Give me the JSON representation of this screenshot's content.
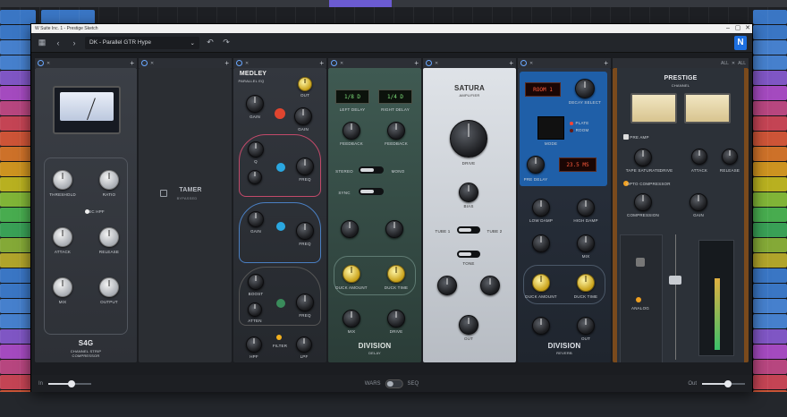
{
  "window": {
    "title": "W Suite Inc. 1 - Prestige Sketch",
    "minimize": "–",
    "maximize": "▢",
    "close": "✕"
  },
  "toolbar": {
    "menu_icon": "grid-icon",
    "prev_icon": "chevron-left-icon",
    "next_icon": "chevron-right-icon",
    "preset_name": "DK - Parallel GTR Hype",
    "preset_caret": "⌄",
    "undo_icon": "undo-icon",
    "redo_icon": "redo-icon",
    "brand": "N"
  },
  "slots": [
    {
      "plugin": "S4G",
      "subtitle": "CHANNEL STRIP COMPRESSOR",
      "controls": [
        "THRESHOLD",
        "RATIO",
        "SC HPF",
        "ATTACK",
        "RELEASE",
        "MIX",
        "OUTPUT"
      ]
    },
    {
      "plugin": "TAMER",
      "subtitle": "BYPASSED"
    },
    {
      "plugin": "MEDLEY",
      "subtitle": "PARALLEL EQ",
      "controls": [
        "OUT",
        "GAIN",
        "FREQ",
        "GAIN",
        "Q",
        "FREQ",
        "GAIN",
        "Q",
        "FREQ",
        "BOOST",
        "ATTEN",
        "FREQ",
        "HPF",
        "FILTER",
        "LPF"
      ]
    },
    {
      "plugin": "DIVISION",
      "subtitle": "DELAY",
      "left_delay": "LEFT DELAY",
      "right_delay": "RIGHT DELAY",
      "left_value": "1/8 D",
      "right_value": "1/4 D",
      "controls": [
        "FEEDBACK",
        "FEEDBACK",
        "STEREO",
        "MONO",
        "SYNC",
        "DUCK AMOUNT",
        "DUCK TIME",
        "MIX",
        "DRIVE"
      ]
    },
    {
      "plugin": "SATURA",
      "subtitle": "AMPLIFIER",
      "controls": [
        "DRIVE",
        "BIAS",
        "TUBE 1",
        "TUBE 2",
        "TONE",
        "OUT"
      ]
    },
    {
      "plugin": "DIVISION",
      "subtitle": "REVERB",
      "room_value": "ROOM 1",
      "decay_value": "23.5 MS",
      "controls": [
        "DECAY SELECT",
        "MODE",
        "PLATE",
        "ROOM",
        "PRE DELAY",
        "LOW DAMP",
        "HIGH DAMP",
        "MIX",
        "DUCK AMOUNT",
        "DUCK TIME",
        "OUT"
      ]
    },
    {
      "plugin": "PRESTIGE",
      "subtitle": "CHANNEL",
      "all_label": "ALL",
      "controls": [
        "PRE AMP",
        "TAPE SATURATE",
        "DRIVE",
        "ATTACK",
        "RELEASE",
        "OPTO COMPRESSOR",
        "COMPRESSION",
        "GAIN",
        "ANALOG"
      ]
    }
  ],
  "footer": {
    "in_label": "In",
    "in_level": 0.55,
    "mix_left": "WARS",
    "mix_right": "SEQ",
    "out_label": "Out",
    "out_level": 0.6
  }
}
